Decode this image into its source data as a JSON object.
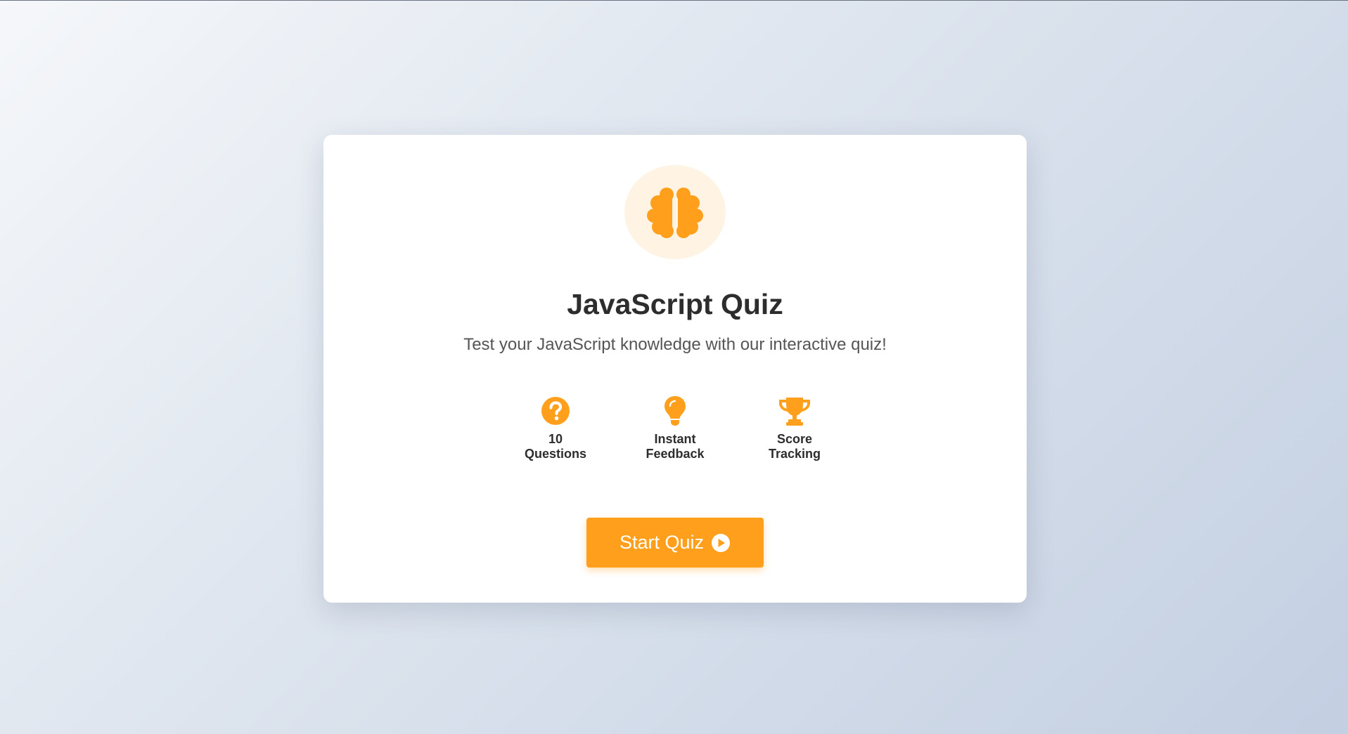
{
  "app": {
    "title": "JavaScript Quiz",
    "subtitle": "Test your JavaScript knowledge with our interactive quiz!",
    "hero_icon": "brain-icon"
  },
  "features": [
    {
      "icon": "question-circle-icon",
      "label": "10 Questions"
    },
    {
      "icon": "lightbulb-icon",
      "label": "Instant Feedback"
    },
    {
      "icon": "trophy-icon",
      "label": "Score Tracking"
    }
  ],
  "start_button": {
    "label": "Start Quiz",
    "icon": "play-circle-icon"
  },
  "colors": {
    "accent": "#ff9f1c",
    "accent_light": "#fff3e3",
    "title_text": "#2d2d2d",
    "subtitle_text": "#555555",
    "card_bg": "#ffffff"
  }
}
